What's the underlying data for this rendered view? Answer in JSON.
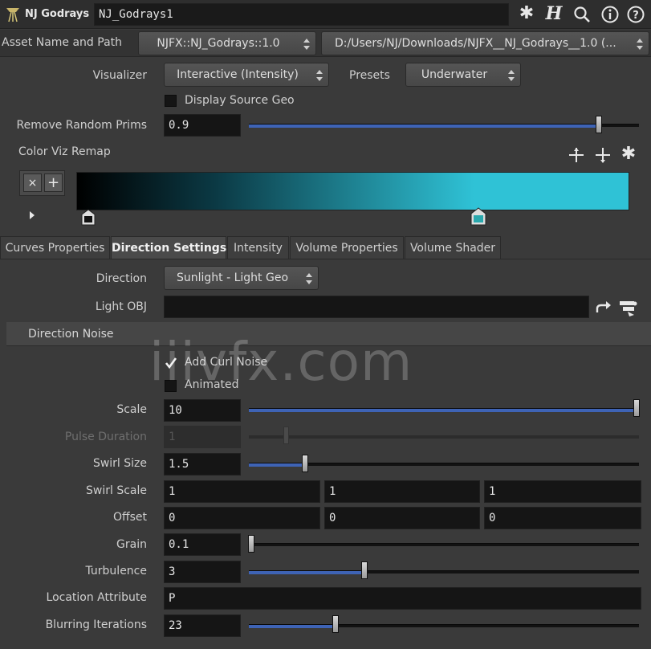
{
  "header": {
    "node_type": "NJ Godrays",
    "node_name": "NJ_Godrays1",
    "icons": [
      "gear-icon",
      "houdini-help-icon",
      "search-icon",
      "info-icon",
      "help-icon"
    ]
  },
  "asset": {
    "label": "Asset Name and Path",
    "name": "NJFX::NJ_Godrays::1.0",
    "path": "D:/Users/NJ/Downloads/NJFX__NJ_Godrays__1.0 (..."
  },
  "visualizer": {
    "label": "Visualizer",
    "value": "Interactive (Intensity)",
    "presets_label": "Presets",
    "presets_value": "Underwater"
  },
  "display_source_geo": {
    "label": "Display Source Geo",
    "checked": false
  },
  "remove_random_prims": {
    "label": "Remove Random Prims",
    "value": "0.9",
    "slider": 0.9
  },
  "color_viz_remap": {
    "label": "Color Viz Remap",
    "remove_key": "×",
    "add_key": "+",
    "gradient_start": "#000000",
    "gradient_end": "#2fc2d6"
  },
  "tabs": [
    {
      "label": "Curves Properties",
      "active": false
    },
    {
      "label": "Direction Settings",
      "active": true
    },
    {
      "label": "Intensity",
      "active": false
    },
    {
      "label": "Volume Properties",
      "active": false
    },
    {
      "label": "Volume Shader",
      "active": false
    }
  ],
  "direction": {
    "label": "Direction",
    "value": "Sunlight - Light Geo"
  },
  "light_obj": {
    "label": "Light OBJ",
    "value": ""
  },
  "direction_noise": {
    "title": "Direction Noise",
    "add_curl_noise": {
      "label": "Add Curl Noise",
      "checked": true
    },
    "animated": {
      "label": "Animated",
      "checked": false
    },
    "scale": {
      "label": "Scale",
      "value": "10",
      "slider": 1.0
    },
    "pulse_duration": {
      "label": "Pulse Duration",
      "value": "1",
      "slider": 0.1,
      "disabled": true
    },
    "swirl_size": {
      "label": "Swirl Size",
      "value": "1.5",
      "slider": 0.15
    },
    "swirl_scale": {
      "label": "Swirl Scale",
      "values": [
        "1",
        "1",
        "1"
      ]
    },
    "offset": {
      "label": "Offset",
      "values": [
        "0",
        "0",
        "0"
      ]
    },
    "grain": {
      "label": "Grain",
      "value": "0.1",
      "slider": 0.0
    },
    "turbulence": {
      "label": "Turbulence",
      "value": "3",
      "slider": 0.3
    },
    "location_attribute": {
      "label": "Location Attribute",
      "value": "P"
    },
    "blurring_iterations": {
      "label": "Blurring Iterations",
      "value": "23",
      "slider": 0.23
    }
  },
  "watermark": "iiivfx.com",
  "colors": {
    "accent": "#3e63b5",
    "panel": "#3a3a3a",
    "field": "#151515"
  }
}
